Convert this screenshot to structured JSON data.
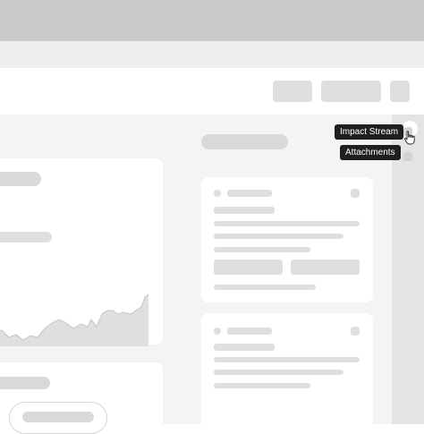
{
  "tooltips": {
    "impact_stream": "Impact Stream",
    "attachments": "Attachments"
  },
  "colors": {
    "titlebar": "#c9cbcd",
    "skeleton": "#dedfe1",
    "panel": "#f3f4f5",
    "tooltip_bg": "#1f1f1f"
  },
  "icons": {
    "rail_top": "circle-icon",
    "rail_impact": "impact-stream-icon",
    "rail_attachments": "attachments-icon",
    "cursor": "hand-pointer-icon"
  }
}
